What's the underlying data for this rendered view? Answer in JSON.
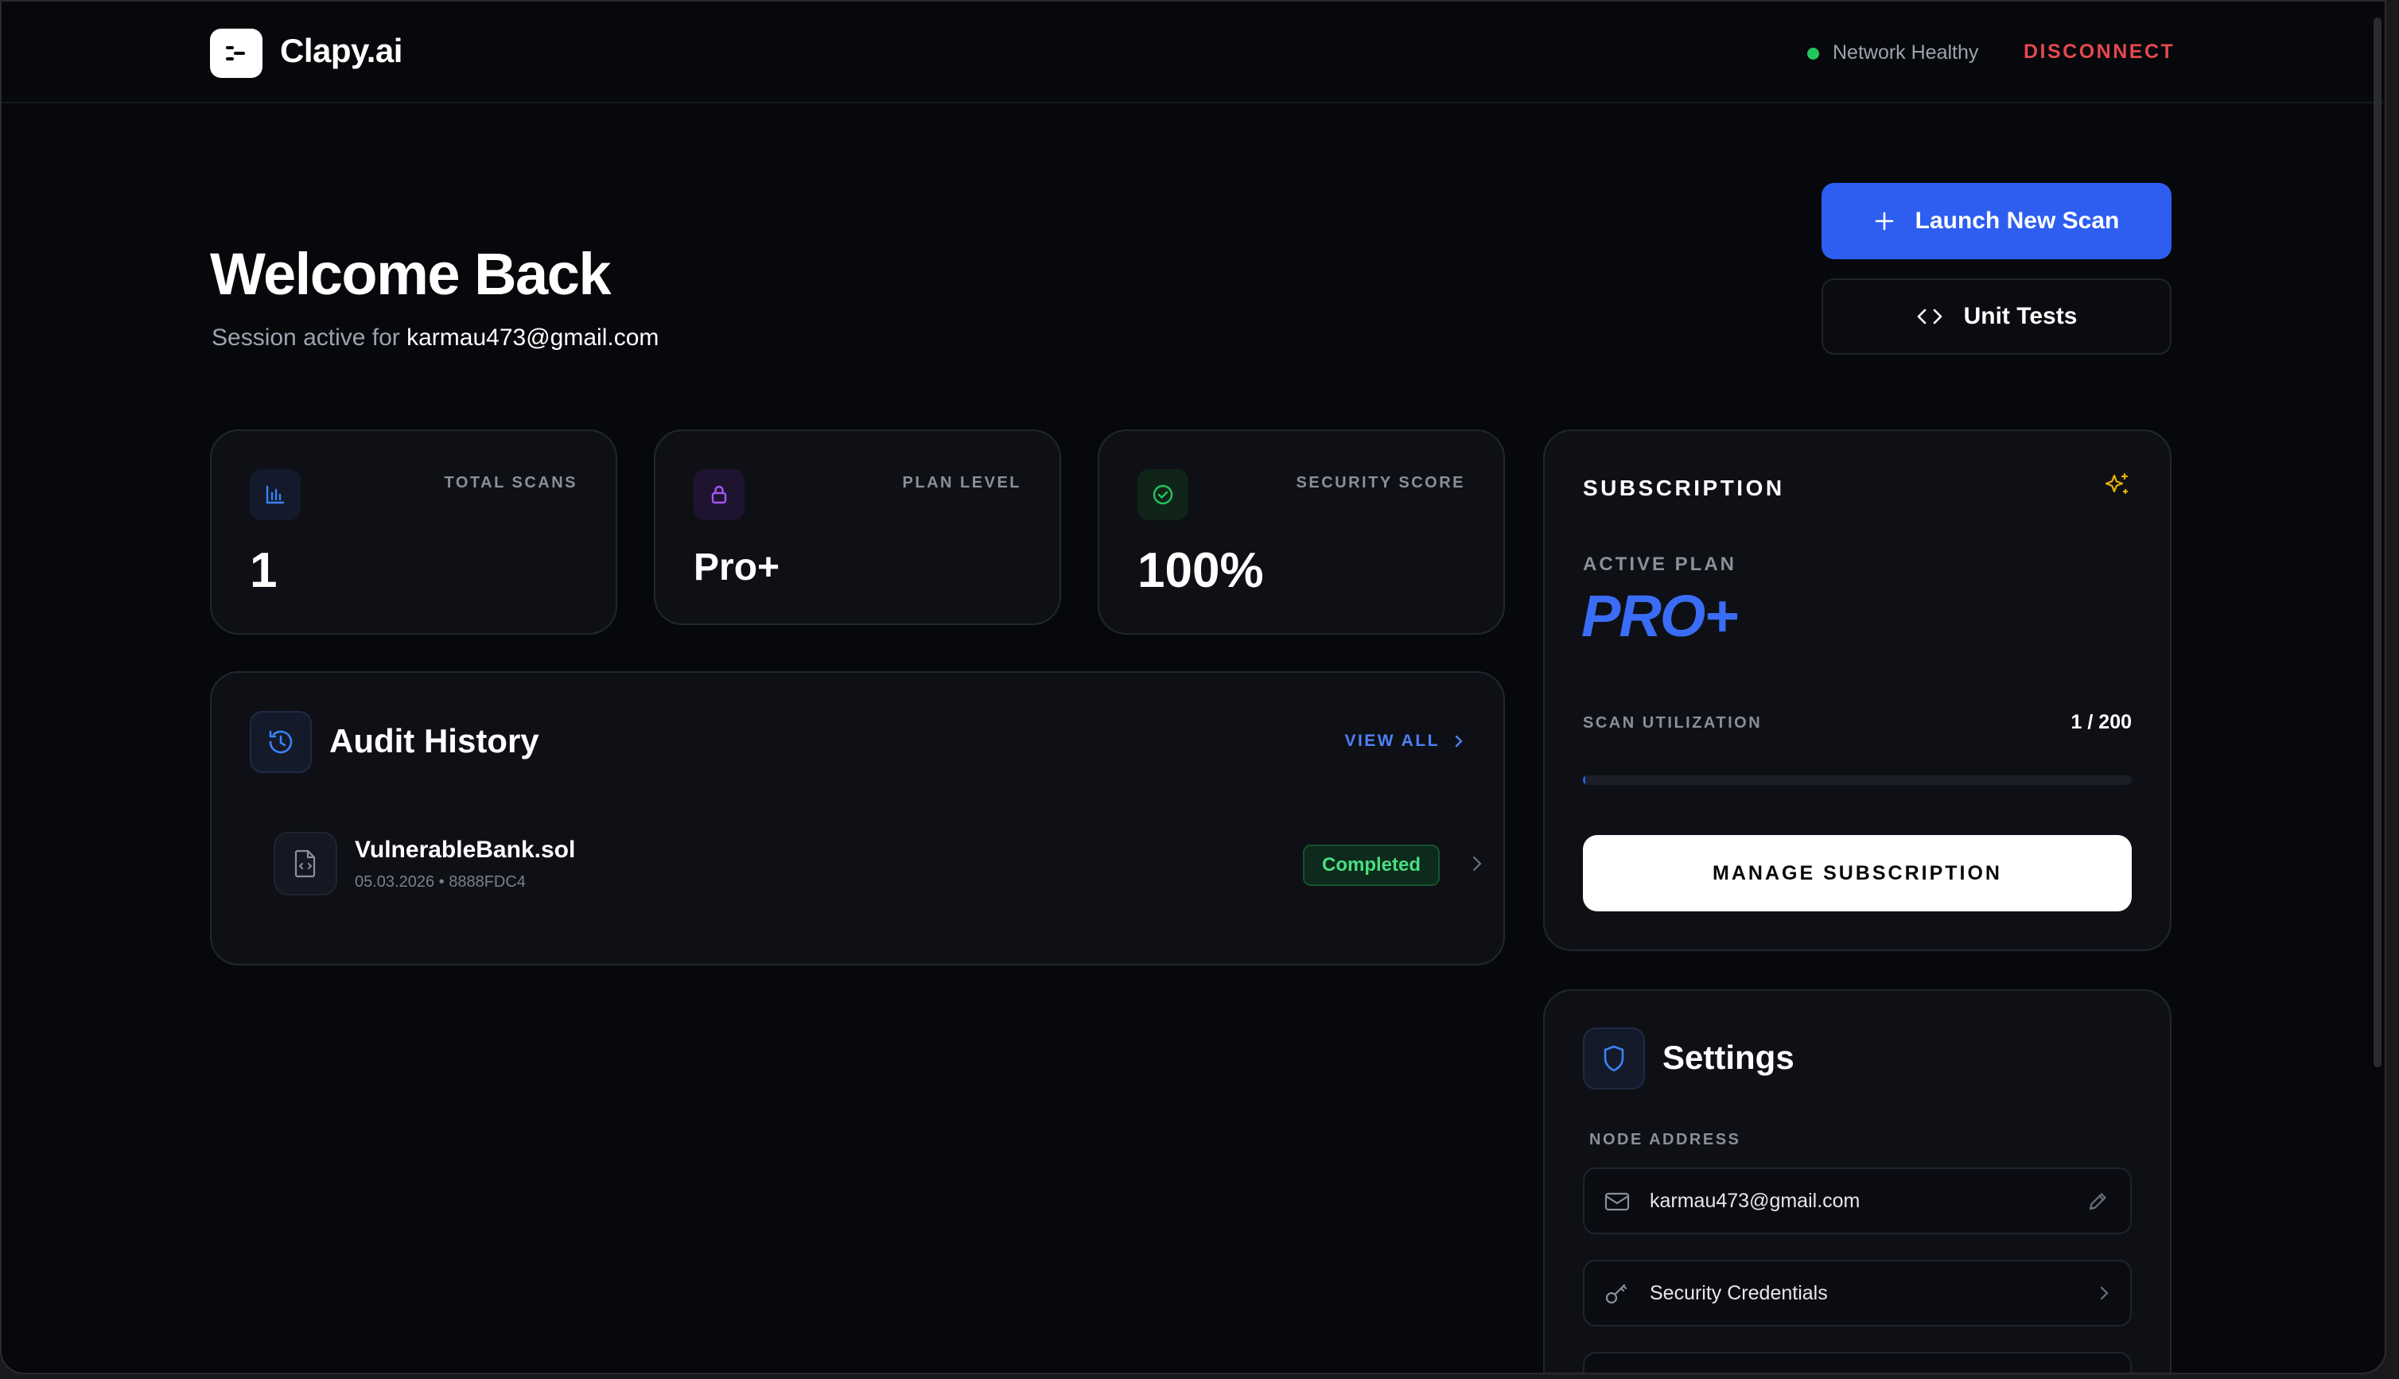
{
  "header": {
    "brand": "Clapy.ai",
    "network_status": "Network Healthy",
    "disconnect_label": "DISCONNECT"
  },
  "welcome": {
    "title": "Welcome Back",
    "session_prefix": "Session active for ",
    "email": "karmau473@gmail.com"
  },
  "actions": {
    "launch_label": "Launch New Scan",
    "unit_tests_label": "Unit Tests"
  },
  "stats": [
    {
      "label": "TOTAL SCANS",
      "value": "1",
      "icon": "bar-chart-icon",
      "color": "#3b82f6"
    },
    {
      "label": "PLAN LEVEL",
      "value": "Pro+",
      "icon": "lock-icon",
      "color": "#a855f7"
    },
    {
      "label": "SECURITY SCORE",
      "value": "100%",
      "icon": "check-circle-icon",
      "color": "#22c55e"
    }
  ],
  "audit": {
    "title": "Audit History",
    "view_all": "VIEW ALL",
    "items": [
      {
        "file": "VulnerableBank.sol",
        "meta": "05.03.2026 • 8888FDC4",
        "status": "Completed"
      }
    ]
  },
  "subscription": {
    "title": "SUBSCRIPTION",
    "active_plan_label": "ACTIVE PLAN",
    "plan_name": "PRO+",
    "utilization_label": "SCAN UTILIZATION",
    "utilization_value": "1 / 200",
    "utilization_used": 1,
    "utilization_total": 200,
    "manage_label": "MANAGE SUBSCRIPTION"
  },
  "settings": {
    "title": "Settings",
    "node_address_label": "NODE ADDRESS",
    "email": "karmau473@gmail.com",
    "credentials_label": "Security Credentials"
  },
  "colors": {
    "accent": "#2d5ef0",
    "danger": "#e5484d",
    "success": "#22c55e",
    "background": "#07080c"
  }
}
